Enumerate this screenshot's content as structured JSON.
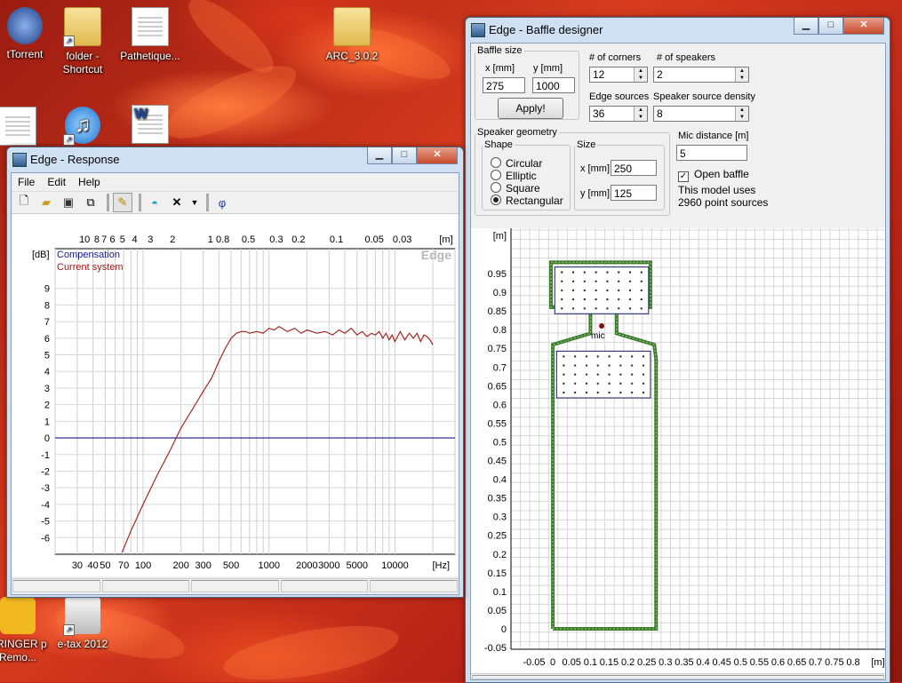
{
  "desktop": {
    "icons": [
      {
        "label": "tTorrent",
        "kind": "app"
      },
      {
        "label": "folder - Shortcut",
        "kind": "folder"
      },
      {
        "label": "Pathetique...",
        "kind": "doc"
      },
      {
        "label": "ARC_3.0.2",
        "kind": "folder"
      },
      {
        "label": "HRINGER p Remo...",
        "kind": "app"
      },
      {
        "label": "e-tax 2012",
        "kind": "app"
      }
    ]
  },
  "response_window": {
    "title": "Edge - Response",
    "buttons": {
      "minimize": "▁",
      "maximize": "□",
      "close": "✕"
    },
    "menu": [
      "File",
      "Edit",
      "Help"
    ],
    "toolbar_icons": [
      "new-icon",
      "open-icon",
      "save-icon",
      "copy-icon",
      "pencil-icon",
      "dome-icon",
      "cross-icon",
      "dropdown-icon",
      "phi-icon"
    ],
    "phi_label": "φ",
    "chart_data": {
      "type": "line",
      "watermark": "Edge",
      "ylabel": "[dB]",
      "xlabel": "[Hz]",
      "top_axis_unit": "[m]",
      "x_scale": "log",
      "xlim": [
        20,
        30000
      ],
      "ylim": [
        -7,
        10
      ],
      "y_ticks": [
        9,
        8,
        7,
        6,
        5,
        4,
        3,
        2,
        1,
        0,
        -1,
        -2,
        -3,
        -4,
        -5,
        -6
      ],
      "y_tick_labels": [
        "9",
        "8",
        "7",
        "6",
        "5",
        "4",
        "3",
        "2",
        "1",
        "0",
        "-1",
        "-2",
        "-3",
        "-4",
        "-5",
        "-6"
      ],
      "x_ticks": [
        30,
        40,
        50,
        70,
        100,
        200,
        300,
        500,
        1000,
        2000,
        3000,
        5000,
        10000
      ],
      "x_tick_labels": [
        "30",
        "40",
        "50",
        "70",
        "100",
        "200",
        "300",
        "500",
        "1000",
        "2000",
        "3000",
        "5000",
        "10000"
      ],
      "top_ticks_m": [
        10,
        8,
        7,
        6,
        5,
        4,
        3,
        2,
        1,
        0.8,
        0.5,
        0.3,
        0.2,
        0.1,
        0.05,
        0.03
      ],
      "top_tick_labels": [
        "10",
        "8",
        "7",
        "6",
        "5",
        "4",
        "3",
        "2",
        "1",
        "0.8",
        "0.5",
        "0.3",
        "0.2",
        "0.1",
        "0.05",
        "0.03"
      ],
      "grid": true,
      "legend_position": "top-left",
      "series": [
        {
          "name": "Compensation",
          "color": "#1a1a8c",
          "x": [
            20,
            30000
          ],
          "y": [
            0,
            0
          ]
        },
        {
          "name": "Current system",
          "color": "#a01818",
          "x": [
            68,
            80,
            100,
            130,
            160,
            200,
            250,
            300,
            350,
            400,
            450,
            500,
            550,
            600,
            650,
            700,
            800,
            900,
            1000,
            1100,
            1200,
            1400,
            1600,
            1800,
            2000,
            2400,
            2800,
            3200,
            3600,
            4000,
            4500,
            5000,
            5500,
            6000,
            6500,
            7000,
            7500,
            8000,
            8500,
            9000,
            9500,
            10000,
            11000,
            12000,
            13000,
            14000,
            15000,
            16000,
            17000,
            18000,
            19000,
            20000
          ],
          "y": [
            -6.9,
            -5.6,
            -4.0,
            -2.2,
            -0.9,
            0.6,
            1.8,
            2.8,
            3.6,
            4.6,
            5.4,
            6.0,
            6.3,
            6.4,
            6.4,
            6.3,
            6.4,
            6.3,
            6.6,
            6.5,
            6.7,
            6.4,
            6.6,
            6.3,
            6.5,
            6.3,
            6.4,
            6.2,
            6.5,
            6.3,
            6.6,
            6.2,
            6.4,
            6.1,
            6.3,
            6.2,
            6.4,
            6.0,
            6.3,
            5.9,
            6.2,
            5.8,
            6.4,
            5.9,
            6.3,
            6.0,
            6.3,
            5.8,
            6.2,
            6.1,
            5.9,
            5.6
          ]
        }
      ]
    }
  },
  "baffle_window": {
    "title": "Edge - Baffle designer",
    "buttons": {
      "minimize": "▁",
      "maximize": "□",
      "close": "✕"
    },
    "baffle_size": {
      "legend": "Baffle size",
      "x_label": "x [mm]",
      "x_value": "275",
      "y_label": "y [mm]",
      "y_value": "1000",
      "apply": "Apply!"
    },
    "corners": {
      "label": "# of corners",
      "value": "12"
    },
    "speakers": {
      "label": "# of speakers",
      "value": "2"
    },
    "edge_sources": {
      "label": "Edge sources",
      "value": "36"
    },
    "speaker_density": {
      "label": "Speaker source density",
      "value": "8"
    },
    "speaker_geometry": {
      "legend": "Speaker geometry",
      "shape_legend": "Shape",
      "shapes": [
        "Circular",
        "Elliptic",
        "Square",
        "Rectangular"
      ],
      "selected_shape": "Rectangular",
      "size_legend": "Size",
      "x_label": "x [mm]",
      "x_value": "250",
      "y_label": "y [mm]",
      "y_value": "125"
    },
    "mic": {
      "label": "Mic distance [m]",
      "value": "5",
      "open_baffle_label": "Open baffle",
      "open_baffle_checked": true
    },
    "model_note_1": "This model uses",
    "model_note_2": "2960 point sources",
    "layout_plot": {
      "y_unit": "[m]",
      "x_unit": "[m]",
      "mic_label": "mic",
      "y_tick_labels": [
        "0.95",
        "0.9",
        "0.85",
        "0.8",
        "0.75",
        "0.7",
        "0.65",
        "0.6",
        "0.55",
        "0.5",
        "0.45",
        "0.4",
        "0.35",
        "0.3",
        "0.25",
        "0.2",
        "0.15",
        "0.1",
        "0.05",
        "0",
        "-0.05"
      ],
      "x_tick_labels": [
        "-0.05",
        "0",
        "0.05",
        "0.1",
        "0.15",
        "0.2",
        "0.25",
        "0.3",
        "0.35",
        "0.4",
        "0.45",
        "0.5",
        "0.55",
        "0.6",
        "0.65",
        "0.7",
        "0.75",
        "0.8"
      ],
      "baffle_color": "#3a7a2a",
      "speaker_outline_color": "#1a1a6a"
    }
  }
}
